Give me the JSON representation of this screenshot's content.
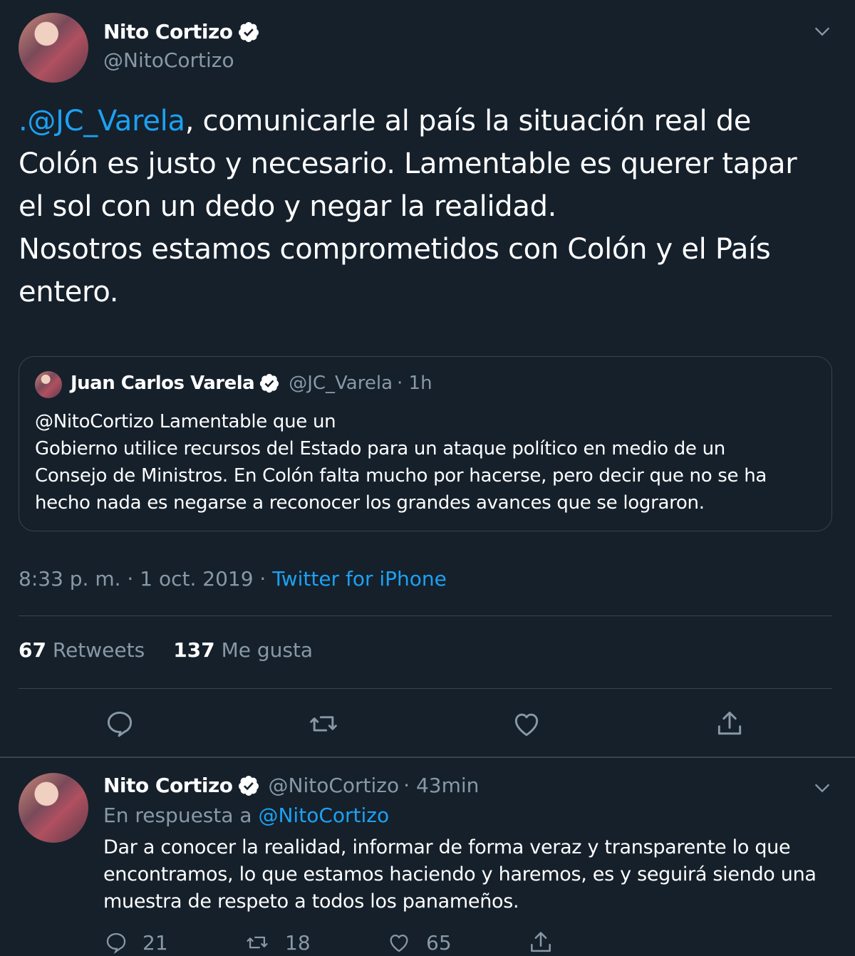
{
  "tweet": {
    "author_name": "Nito Cortizo",
    "author_handle": "@NitoCortizo",
    "text_mention": ".@JC_Varela",
    "text_body": ", comunicarle al país la situación real de\nColón es justo y necesario. Lamentable es querer tapar\nel sol con un dedo y negar la realidad.\nNosotros estamos comprometidos con Colón y el País\nentero.",
    "timestamp": "8:33 p. m. · 1 oct. 2019 · ",
    "source": "Twitter for iPhone",
    "retweets_count": "67",
    "retweets_label": "Retweets",
    "likes_count": "137",
    "likes_label": "Me gusta"
  },
  "quoted": {
    "author_name": "Juan Carlos Varela",
    "author_handle": "@JC_Varela",
    "time": "· 1h",
    "text": "@NitoCortizo Lamentable que un\nGobierno utilice recursos del Estado para un ataque político en medio de un\nConsejo de Ministros. En Colón falta mucho por hacerse, pero decir que no se ha\nhecho nada es negarse a reconocer los grandes avances que se lograron."
  },
  "reply": {
    "author_name": "Nito Cortizo",
    "author_handle": "@NitoCortizo",
    "time": "· 43min",
    "in_reply_label": "En respuesta a ",
    "in_reply_handle": "@NitoCortizo",
    "text": "Dar a conocer la realidad, informar de forma veraz y transparente lo que\nencontramos, lo que estamos haciendo y haremos, es y seguirá siendo una\nmuestra de respeto a todos los panameños.",
    "reply_count": "21",
    "retweet_count": "18",
    "like_count": "65"
  },
  "colors": {
    "background": "#15202b",
    "link": "#1da1f2",
    "muted": "#8899a6",
    "border": "#38444d"
  },
  "icons": [
    "verified-badge-icon",
    "chevron-down-icon",
    "reply-icon",
    "retweet-icon",
    "like-icon",
    "share-icon"
  ]
}
